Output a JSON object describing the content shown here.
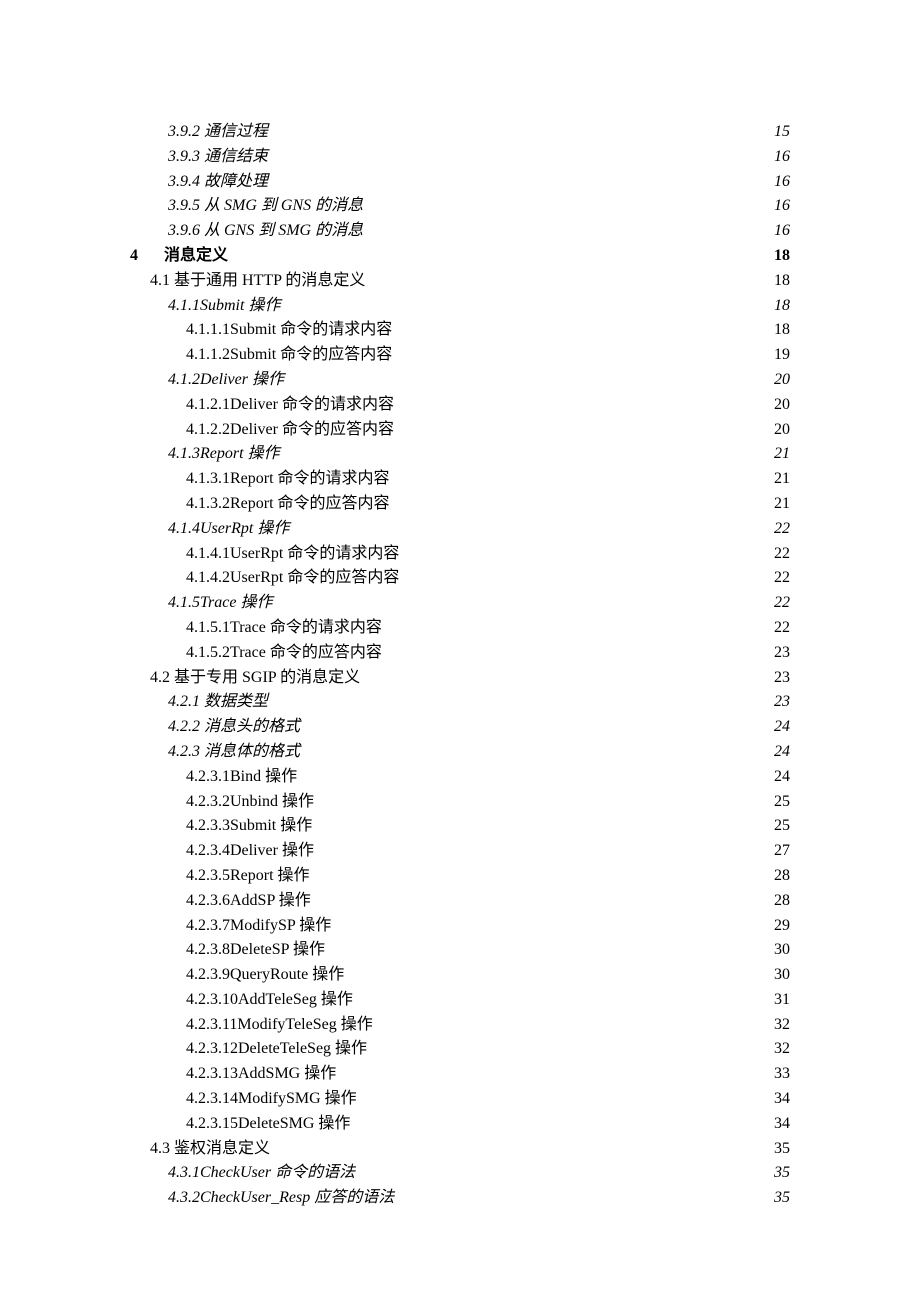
{
  "toc": [
    {
      "level": 2,
      "title": "3.9.2 通信过程",
      "page": "15",
      "italic": true
    },
    {
      "level": 2,
      "title": "3.9.3 通信结束",
      "page": "16",
      "italic": true
    },
    {
      "level": 2,
      "title": "3.9.4 故障处理",
      "page": "16",
      "italic": true
    },
    {
      "level": 2,
      "title": "3.9.5 从 SMG 到 GNS 的消息",
      "page": "16",
      "italic": true
    },
    {
      "level": 2,
      "title": "3.9.6 从 GNS 到 SMG 的消息",
      "page": "16",
      "italic": true
    },
    {
      "level": 0,
      "chapter": "4",
      "title": "消息定义",
      "page": "18",
      "bold": true
    },
    {
      "level": 1,
      "title": "4.1 基于通用 HTTP 的消息定义",
      "page": "18"
    },
    {
      "level": 2,
      "title": "4.1.1Submit 操作",
      "page": "18",
      "italic": true
    },
    {
      "level": 3,
      "title": "4.1.1.1Submit 命令的请求内容",
      "page": "18"
    },
    {
      "level": 3,
      "title": "4.1.1.2Submit 命令的应答内容",
      "page": "19"
    },
    {
      "level": 2,
      "title": "4.1.2Deliver 操作",
      "page": "20",
      "italic": true
    },
    {
      "level": 3,
      "title": "4.1.2.1Deliver 命令的请求内容",
      "page": "20"
    },
    {
      "level": 3,
      "title": "4.1.2.2Deliver 命令的应答内容",
      "page": "20"
    },
    {
      "level": 2,
      "title": "4.1.3Report 操作",
      "page": "21",
      "italic": true
    },
    {
      "level": 3,
      "title": "4.1.3.1Report 命令的请求内容",
      "page": "21"
    },
    {
      "level": 3,
      "title": "4.1.3.2Report 命令的应答内容",
      "page": "21"
    },
    {
      "level": 2,
      "title": "4.1.4UserRpt 操作",
      "page": "22",
      "italic": true
    },
    {
      "level": 3,
      "title": "4.1.4.1UserRpt 命令的请求内容",
      "page": "22"
    },
    {
      "level": 3,
      "title": "4.1.4.2UserRpt 命令的应答内容",
      "page": "22"
    },
    {
      "level": 2,
      "title": "4.1.5Trace 操作",
      "page": "22",
      "italic": true
    },
    {
      "level": 3,
      "title": "4.1.5.1Trace 命令的请求内容",
      "page": "22"
    },
    {
      "level": 3,
      "title": "4.1.5.2Trace 命令的应答内容",
      "page": "23"
    },
    {
      "level": 1,
      "title": "4.2 基于专用 SGIP 的消息定义",
      "page": "23"
    },
    {
      "level": 2,
      "title": "4.2.1 数据类型",
      "page": "23",
      "italic": true
    },
    {
      "level": 2,
      "title": "4.2.2 消息头的格式",
      "page": "24",
      "italic": true
    },
    {
      "level": 2,
      "title": "4.2.3 消息体的格式",
      "page": "24",
      "italic": true
    },
    {
      "level": 3,
      "title": "4.2.3.1Bind 操作",
      "page": "24"
    },
    {
      "level": 3,
      "title": "4.2.3.2Unbind 操作",
      "page": "25"
    },
    {
      "level": 3,
      "title": "4.2.3.3Submit 操作",
      "page": "25"
    },
    {
      "level": 3,
      "title": "4.2.3.4Deliver 操作",
      "page": "27"
    },
    {
      "level": 3,
      "title": "4.2.3.5Report 操作",
      "page": "28"
    },
    {
      "level": 3,
      "title": "4.2.3.6AddSP 操作",
      "page": "28"
    },
    {
      "level": 3,
      "title": "4.2.3.7ModifySP 操作",
      "page": "29"
    },
    {
      "level": 3,
      "title": "4.2.3.8DeleteSP 操作",
      "page": "30"
    },
    {
      "level": 3,
      "title": "4.2.3.9QueryRoute 操作",
      "page": "30"
    },
    {
      "level": 3,
      "title": "4.2.3.10AddTeleSeg 操作",
      "page": "31"
    },
    {
      "level": 3,
      "title": "4.2.3.11ModifyTeleSeg 操作",
      "page": "32"
    },
    {
      "level": 3,
      "title": "4.2.3.12DeleteTeleSeg 操作",
      "page": "32"
    },
    {
      "level": 3,
      "title": "4.2.3.13AddSMG 操作",
      "page": "33"
    },
    {
      "level": 3,
      "title": "4.2.3.14ModifySMG 操作",
      "page": "34"
    },
    {
      "level": 3,
      "title": "4.2.3.15DeleteSMG 操作",
      "page": "34"
    },
    {
      "level": 1,
      "title": "4.3 鉴权消息定义",
      "page": "35"
    },
    {
      "level": 2,
      "title": "4.3.1CheckUser 命令的语法",
      "page": "35",
      "italic": true
    },
    {
      "level": 2,
      "title": "4.3.2CheckUser_Resp 应答的语法",
      "page": "35",
      "italic": true
    }
  ]
}
